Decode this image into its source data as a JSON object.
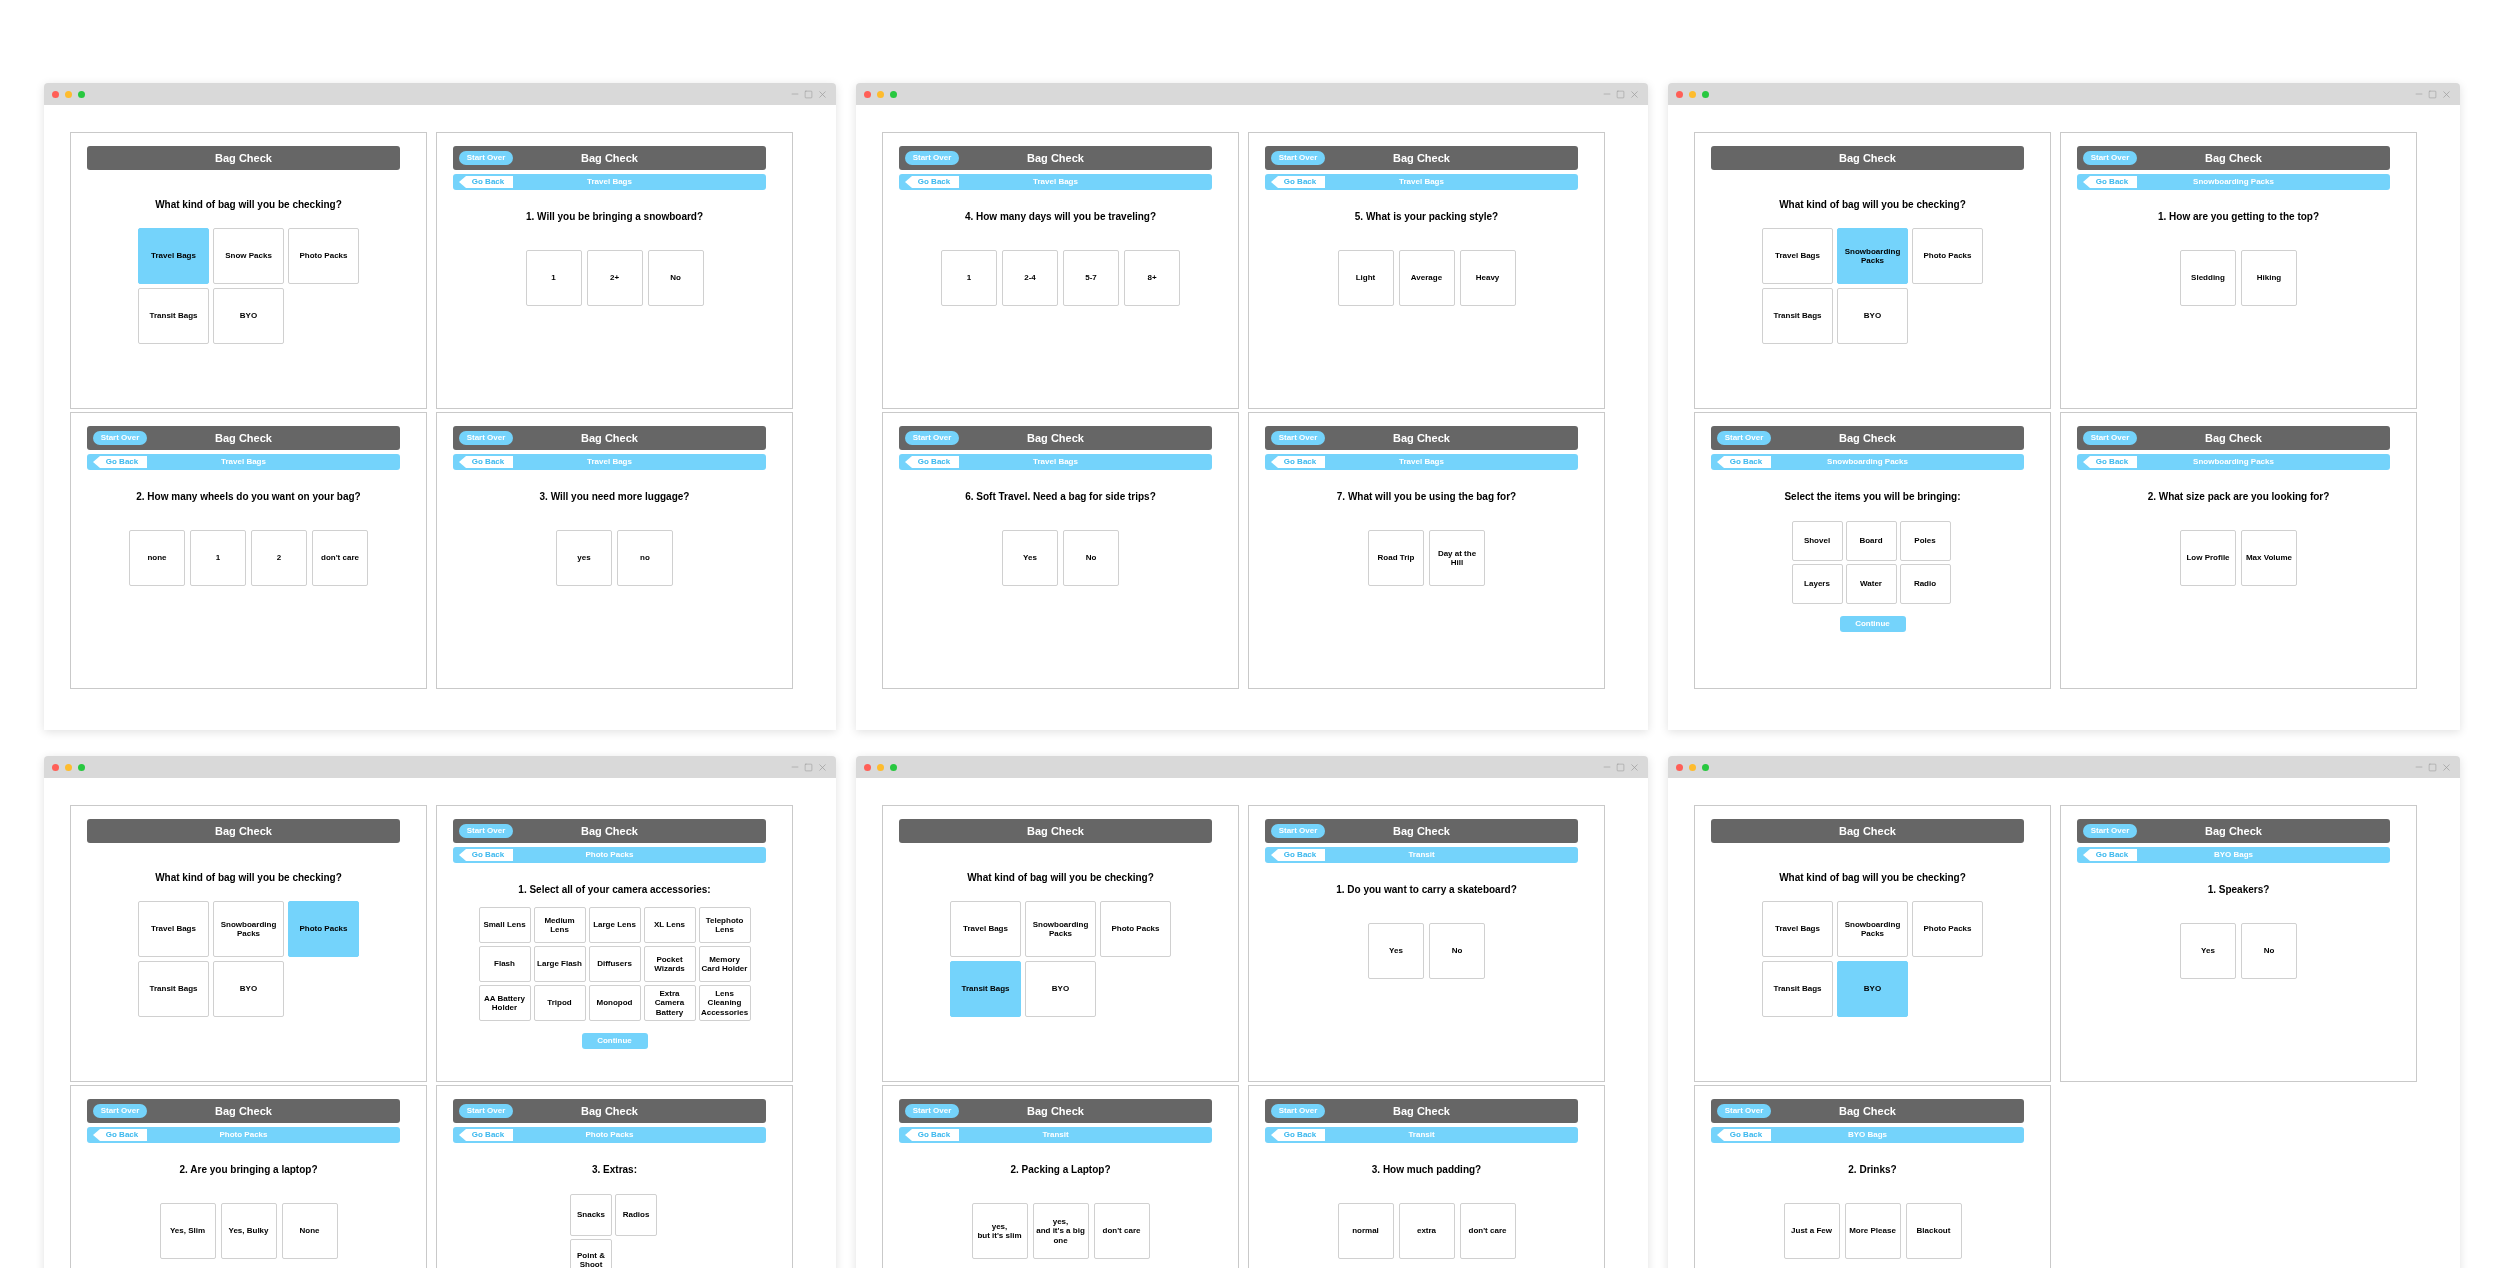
{
  "windows": [
    {
      "screens": [
        {
          "kind": "bag-type",
          "title": "Bag Check",
          "question": "What kind of bag will you be checking?",
          "options": [
            {
              "label": "Travel Bags",
              "selected": true
            },
            {
              "label": "Snow Packs",
              "selected": false
            },
            {
              "label": "Photo Packs",
              "selected": false
            },
            {
              "label": "Transit Bags",
              "selected": false
            },
            {
              "label": "BYO",
              "selected": false
            }
          ]
        },
        {
          "kind": "answers",
          "title": "Bag Check",
          "start_over": "Start Over",
          "go_back": "Go Back",
          "section": "Travel Bags",
          "question": "1. Will you be bringing a snowboard?",
          "options": [
            {
              "label": "1",
              "selected": false
            },
            {
              "label": "2+",
              "selected": false
            },
            {
              "label": "No",
              "selected": false
            }
          ]
        },
        {
          "kind": "answers",
          "title": "Bag Check",
          "start_over": "Start Over",
          "go_back": "Go Back",
          "section": "Travel Bags",
          "question": "2. How many wheels do you want on your bag?",
          "options": [
            {
              "label": "none",
              "selected": false
            },
            {
              "label": "1",
              "selected": false
            },
            {
              "label": "2",
              "selected": false
            },
            {
              "label": "don't care",
              "selected": false
            }
          ]
        },
        {
          "kind": "answers",
          "title": "Bag Check",
          "start_over": "Start Over",
          "go_back": "Go Back",
          "section": "Travel Bags",
          "question": "3. Will you need more luggage?",
          "options": [
            {
              "label": "yes",
              "selected": false
            },
            {
              "label": "no",
              "selected": false
            }
          ]
        }
      ]
    },
    {
      "screens": [
        {
          "kind": "answers",
          "title": "Bag Check",
          "start_over": "Start Over",
          "go_back": "Go Back",
          "section": "Travel Bags",
          "question": "4. How many days will you be traveling?",
          "options": [
            {
              "label": "1",
              "selected": false
            },
            {
              "label": "2-4",
              "selected": false
            },
            {
              "label": "5-7",
              "selected": false
            },
            {
              "label": "8+",
              "selected": false
            }
          ]
        },
        {
          "kind": "answers",
          "title": "Bag Check",
          "start_over": "Start Over",
          "go_back": "Go Back",
          "section": "Travel Bags",
          "question": "5. What is your packing style?",
          "options": [
            {
              "label": "Light",
              "selected": false
            },
            {
              "label": "Average",
              "selected": false
            },
            {
              "label": "Heavy",
              "selected": false
            }
          ]
        },
        {
          "kind": "answers",
          "title": "Bag Check",
          "start_over": "Start Over",
          "go_back": "Go Back",
          "section": "Travel Bags",
          "question": "6. Soft Travel. Need a bag for side trips?",
          "options": [
            {
              "label": "Yes",
              "selected": false
            },
            {
              "label": "No",
              "selected": false
            }
          ]
        },
        {
          "kind": "answers",
          "title": "Bag Check",
          "start_over": "Start Over",
          "go_back": "Go Back",
          "section": "Travel Bags",
          "question": "7. What will you be using the bag for?",
          "options": [
            {
              "label": "Road Trip",
              "selected": false
            },
            {
              "label": "Day at the Hill",
              "selected": false
            }
          ]
        }
      ]
    },
    {
      "screens": [
        {
          "kind": "bag-type",
          "title": "Bag Check",
          "question": "What kind of bag will you be checking?",
          "options": [
            {
              "label": "Travel Bags",
              "selected": false
            },
            {
              "label": "Snowboarding Packs",
              "selected": true
            },
            {
              "label": "Photo Packs",
              "selected": false
            },
            {
              "label": "Transit Bags",
              "selected": false
            },
            {
              "label": "BYO",
              "selected": false
            }
          ]
        },
        {
          "kind": "answers",
          "title": "Bag Check",
          "start_over": "Start Over",
          "go_back": "Go Back",
          "section": "Snowboarding Packs",
          "question": "1. How are you getting to the top?",
          "options": [
            {
              "label": "Sledding",
              "selected": false
            },
            {
              "label": "Hiking",
              "selected": false
            }
          ]
        },
        {
          "kind": "grid",
          "title": "Bag Check",
          "start_over": "Start Over",
          "go_back": "Go Back",
          "section": "Snowboarding Packs",
          "question": "Select the items you will be bringing:",
          "options": [
            {
              "label": "Shovel",
              "selected": false
            },
            {
              "label": "Board",
              "selected": false
            },
            {
              "label": "Poles",
              "selected": false
            },
            {
              "label": "Layers",
              "selected": false
            },
            {
              "label": "Water",
              "selected": false
            },
            {
              "label": "Radio",
              "selected": false
            }
          ],
          "continue": "Continue"
        },
        {
          "kind": "answers",
          "title": "Bag Check",
          "start_over": "Start Over",
          "go_back": "Go Back",
          "section": "Snowboarding Packs",
          "question": "2. What size pack are you looking for?",
          "options": [
            {
              "label": "Low Profile",
              "selected": false
            },
            {
              "label": "Max Volume",
              "selected": false
            }
          ]
        }
      ]
    },
    {
      "screens": [
        {
          "kind": "bag-type",
          "title": "Bag Check",
          "question": "What kind of bag will you be checking?",
          "options": [
            {
              "label": "Travel Bags",
              "selected": false
            },
            {
              "label": "Snowboarding Packs",
              "selected": false
            },
            {
              "label": "Photo Packs",
              "selected": true
            },
            {
              "label": "Transit Bags",
              "selected": false
            },
            {
              "label": "BYO",
              "selected": false
            }
          ]
        },
        {
          "kind": "grid",
          "title": "Bag Check",
          "start_over": "Start Over",
          "go_back": "Go Back",
          "section": "Photo Packs",
          "question": "1. Select all of your camera accessories:",
          "options": [
            {
              "label": "Small Lens",
              "selected": false
            },
            {
              "label": "Medium Lens",
              "selected": false
            },
            {
              "label": "Large Lens",
              "selected": false
            },
            {
              "label": "XL Lens",
              "selected": false
            },
            {
              "label": "Telephoto Lens",
              "selected": false
            },
            {
              "label": "Flash",
              "selected": false
            },
            {
              "label": "Large Flash",
              "selected": false
            },
            {
              "label": "Diffusers",
              "selected": false
            },
            {
              "label": "Pocket Wizards",
              "selected": false
            },
            {
              "label": "Memory Card Holder",
              "selected": false
            },
            {
              "label": "AA Battery Holder",
              "selected": false
            },
            {
              "label": "Tripod",
              "selected": false
            },
            {
              "label": "Monopod",
              "selected": false
            },
            {
              "label": "Extra Camera Battery",
              "selected": false
            },
            {
              "label": "Lens Cleaning Accessories",
              "selected": false
            }
          ],
          "continue": "Continue"
        },
        {
          "kind": "answers",
          "title": "Bag Check",
          "start_over": "Start Over",
          "go_back": "Go Back",
          "section": "Photo Packs",
          "question": "2. Are you bringing a laptop?",
          "options": [
            {
              "label": "Yes, Slim",
              "selected": false
            },
            {
              "label": "Yes, Bulky",
              "selected": false
            },
            {
              "label": "None",
              "selected": false
            }
          ]
        },
        {
          "kind": "grid",
          "title": "Bag Check",
          "start_over": "Start Over",
          "go_back": "Go Back",
          "section": "Photo Packs",
          "question": "3. Extras:",
          "options": [
            {
              "label": "Snacks",
              "selected": false
            },
            {
              "label": "Radios",
              "selected": false
            },
            {
              "label": "Point & Shoot",
              "selected": false
            }
          ]
        }
      ]
    },
    {
      "screens": [
        {
          "kind": "bag-type",
          "title": "Bag Check",
          "question": "What kind of bag will you be checking?",
          "options": [
            {
              "label": "Travel Bags",
              "selected": false
            },
            {
              "label": "Snowboarding Packs",
              "selected": false
            },
            {
              "label": "Photo Packs",
              "selected": false
            },
            {
              "label": "Transit Bags",
              "selected": true
            },
            {
              "label": "BYO",
              "selected": false
            }
          ]
        },
        {
          "kind": "answers",
          "title": "Bag Check",
          "start_over": "Start Over",
          "go_back": "Go Back",
          "section": "Transit",
          "question": "1. Do you want to carry a skateboard?",
          "options": [
            {
              "label": "Yes",
              "selected": false
            },
            {
              "label": "No",
              "selected": false
            }
          ]
        },
        {
          "kind": "answers",
          "title": "Bag Check",
          "start_over": "Start Over",
          "go_back": "Go Back",
          "section": "Transit",
          "question": "2. Packing a Laptop?",
          "options": [
            {
              "label": "yes,\nbut it's slim",
              "selected": false
            },
            {
              "label": "yes,\nand it's a big one",
              "selected": false
            },
            {
              "label": "don't care",
              "selected": false
            }
          ]
        },
        {
          "kind": "answers",
          "title": "Bag Check",
          "start_over": "Start Over",
          "go_back": "Go Back",
          "section": "Transit",
          "question": "3. How much padding?",
          "options": [
            {
              "label": "normal",
              "selected": false
            },
            {
              "label": "extra",
              "selected": false
            },
            {
              "label": "don't care",
              "selected": false
            }
          ]
        }
      ]
    },
    {
      "screens": [
        {
          "kind": "bag-type",
          "title": "Bag Check",
          "question": "What kind of bag will you be checking?",
          "options": [
            {
              "label": "Travel Bags",
              "selected": false
            },
            {
              "label": "Snowboarding Packs",
              "selected": false
            },
            {
              "label": "Photo Packs",
              "selected": false
            },
            {
              "label": "Transit Bags",
              "selected": false
            },
            {
              "label": "BYO",
              "selected": true
            }
          ]
        },
        {
          "kind": "answers",
          "title": "Bag Check",
          "start_over": "Start Over",
          "go_back": "Go Back",
          "section": "BYO Bags",
          "question": "1. Speakers?",
          "options": [
            {
              "label": "Yes",
              "selected": false
            },
            {
              "label": "No",
              "selected": false
            }
          ]
        },
        {
          "kind": "answers",
          "title": "Bag Check",
          "start_over": "Start Over",
          "go_back": "Go Back",
          "section": "BYO Bags",
          "question": "2. Drinks?",
          "options": [
            {
              "label": "Just a Few",
              "selected": false
            },
            {
              "label": "More Please",
              "selected": false
            },
            {
              "label": "Blackout",
              "selected": false
            }
          ]
        }
      ]
    }
  ]
}
